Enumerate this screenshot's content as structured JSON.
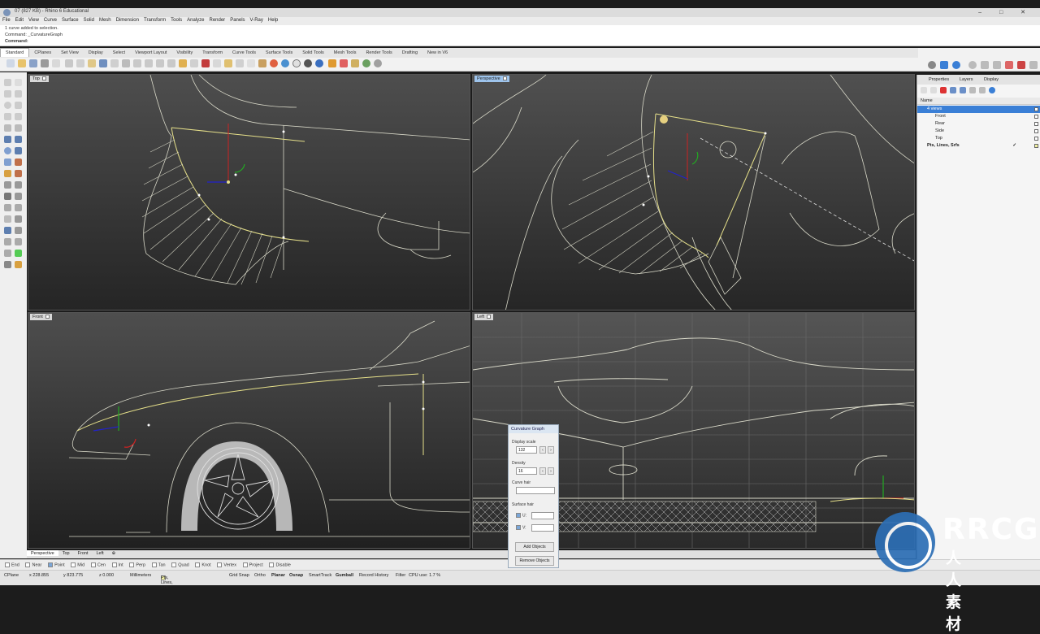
{
  "window": {
    "title": "07 (827 KB) - Rhino 6 Educational"
  },
  "menu": [
    "File",
    "Edit",
    "View",
    "Curve",
    "Surface",
    "Solid",
    "Mesh",
    "Dimension",
    "Transform",
    "Tools",
    "Analyze",
    "Render",
    "Panels",
    "V-Ray",
    "Help"
  ],
  "command_history": {
    "line1": "1 curve added to selection.",
    "line2": "Command: _CurvatureGraph",
    "prompt": "Command:"
  },
  "toolbar_tabs": [
    "Standard",
    "CPlanes",
    "Set View",
    "Display",
    "Select",
    "Viewport Layout",
    "Visibility",
    "Transform",
    "Curve Tools",
    "Surface Tools",
    "Solid Tools",
    "Mesh Tools",
    "Render Tools",
    "Drafting",
    "New in V6"
  ],
  "viewports": {
    "top": "Top",
    "perspective": "Perspective",
    "front": "Front",
    "left": "Left"
  },
  "viewport_tabs": [
    "Perspective",
    "Top",
    "Front",
    "Left"
  ],
  "panel": {
    "tabs": {
      "properties": "Properties",
      "layers": "Layers",
      "display": "Display"
    },
    "header_name": "Name",
    "layers": [
      {
        "name": "4 views",
        "selected": true
      },
      {
        "name": "Front",
        "selected": false
      },
      {
        "name": "Rear",
        "selected": false
      },
      {
        "name": "Side",
        "selected": false
      },
      {
        "name": "Top",
        "selected": false
      },
      {
        "name": "Pts, Lines, Srfs",
        "selected": false,
        "current": true
      }
    ]
  },
  "curvature_graph": {
    "title": "Curvature Graph",
    "display_scale_label": "Display scale",
    "display_scale_value": "132",
    "density_label": "Density",
    "density_value": "16",
    "curve_hair_label": "Curve hair",
    "surface_hair_label": "Surface hair",
    "u_label": "U:",
    "v_label": "V:",
    "add_objects": "Add Objects",
    "remove_objects": "Remove Objects"
  },
  "osnap": [
    {
      "label": "End",
      "on": false
    },
    {
      "label": "Near",
      "on": false
    },
    {
      "label": "Point",
      "on": true
    },
    {
      "label": "Mid",
      "on": false
    },
    {
      "label": "Cen",
      "on": false
    },
    {
      "label": "Int",
      "on": false
    },
    {
      "label": "Perp",
      "on": false
    },
    {
      "label": "Tan",
      "on": false
    },
    {
      "label": "Quad",
      "on": false
    },
    {
      "label": "Knot",
      "on": false
    },
    {
      "label": "Vertex",
      "on": false
    },
    {
      "label": "Project",
      "on": false
    },
    {
      "label": "Disable",
      "on": false
    }
  ],
  "status": {
    "cplane": "CPlane",
    "x": "x 228.855",
    "y": "y 823.775",
    "z": "z 0.000",
    "units": "Millimeters",
    "layer": "Pts, Lines, Srfs",
    "grid_snap": "Grid Snap",
    "ortho": "Ortho",
    "planar": "Planar",
    "osnap": "Osnap",
    "smarttrack": "SmartTrack",
    "gumball": "Gumball",
    "record_history": "Record History",
    "filter": "Filter",
    "cpu": "CPU use: 1.7 %"
  },
  "watermark": {
    "brand": "RRCG",
    "sub": "人人素材"
  },
  "colors": {
    "accent": "#3a7fd6",
    "viewport_bg_top": "#4a4a4a",
    "viewport_bg_bottom": "#1a1a1a",
    "curve_yellow": "#e6e08a"
  }
}
